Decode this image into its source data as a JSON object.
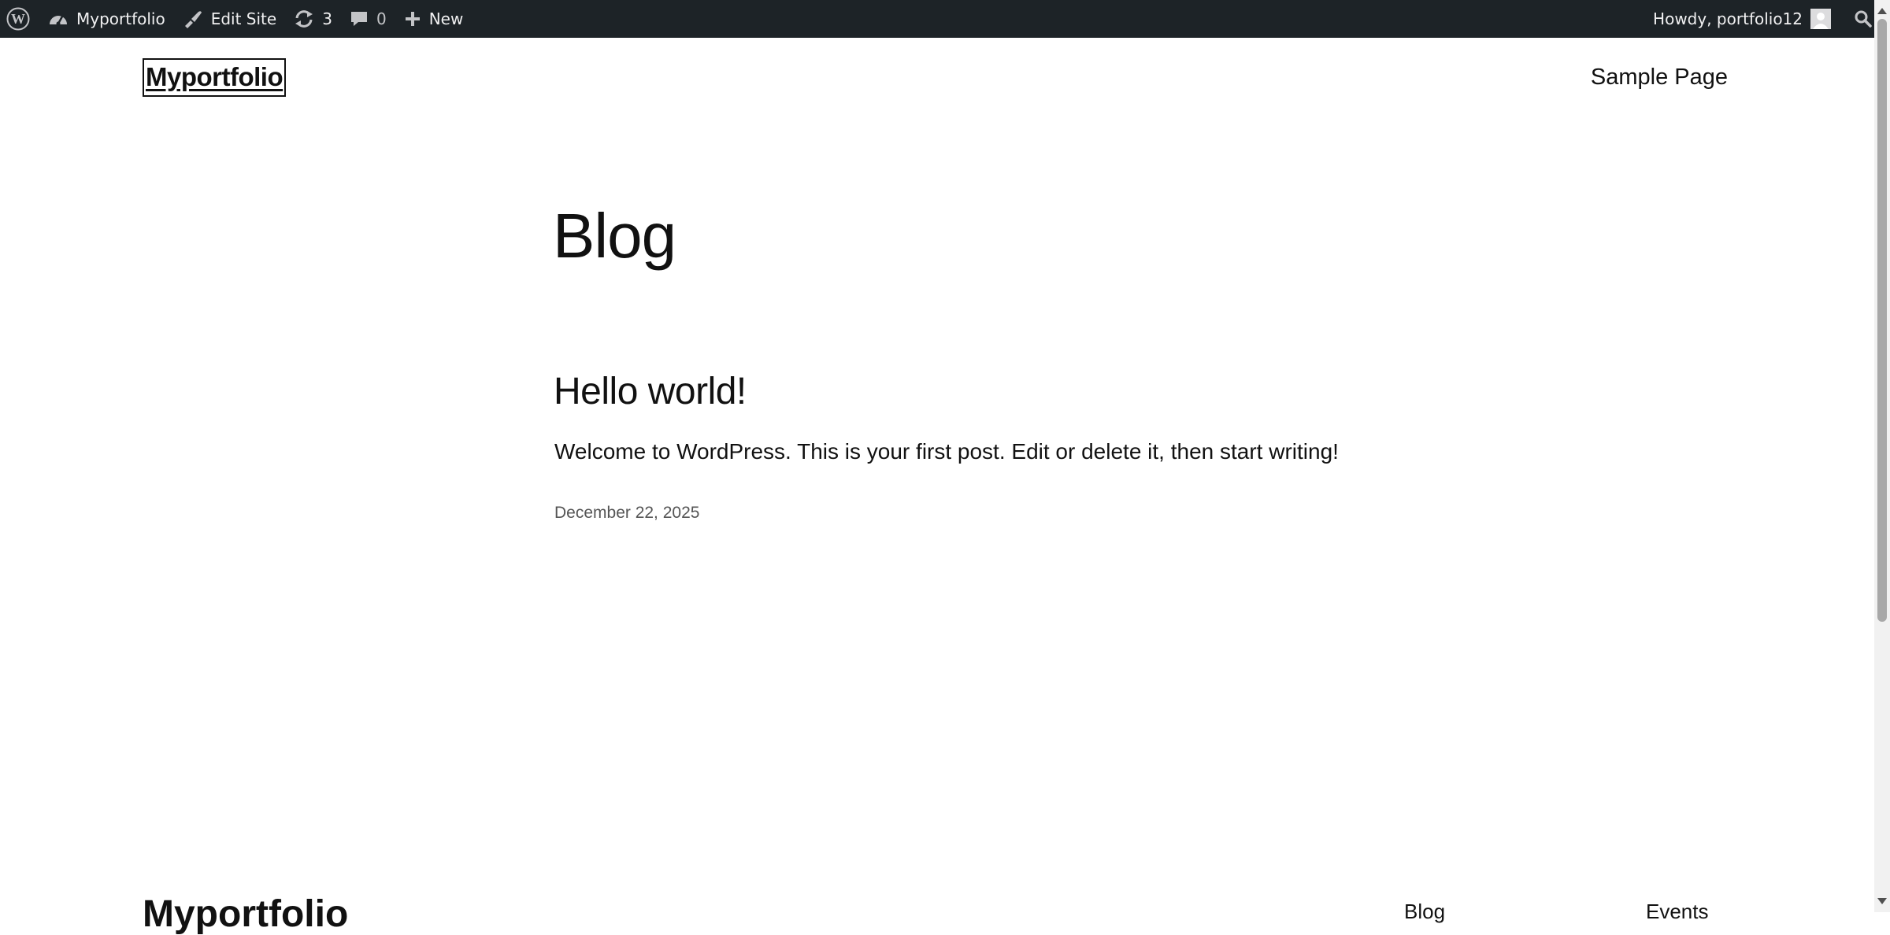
{
  "admin_bar": {
    "site_name": "Myportfolio",
    "edit_site": "Edit Site",
    "updates_count": "3",
    "comments_count": "0",
    "new_label": "New",
    "howdy": "Howdy, portfolio12"
  },
  "header": {
    "site_title": "Myportfolio",
    "nav": [
      "Sample Page"
    ]
  },
  "main": {
    "page_title": "Blog",
    "posts": [
      {
        "title": "Hello world!",
        "excerpt": "Welcome to WordPress. This is your first post. Edit or delete it, then start writing!",
        "date": "December 22, 2025"
      }
    ]
  },
  "footer": {
    "site_title": "Myportfolio",
    "links": [
      "Blog",
      "Events"
    ]
  },
  "icons": {
    "wp_logo": "wordpress-icon",
    "dashboard": "dashboard-icon",
    "edit": "brush-icon",
    "updates": "updates-icon",
    "comments": "comment-icon",
    "new": "plus-icon",
    "search": "search-icon"
  }
}
